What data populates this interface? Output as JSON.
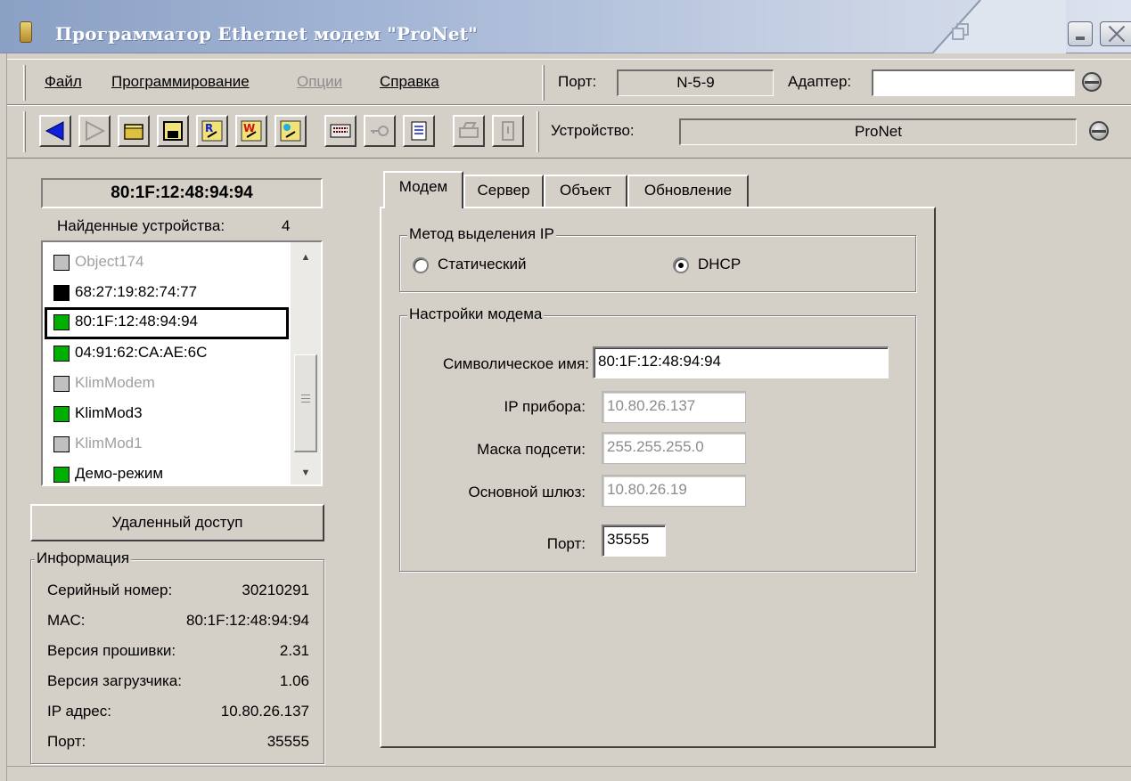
{
  "window": {
    "title": "Программатор Ethernet модем \"ProNet\""
  },
  "menu": {
    "items": [
      {
        "label": "Файл",
        "enabled": true
      },
      {
        "label": "Программирование",
        "enabled": true
      },
      {
        "label": "Опции",
        "enabled": false
      },
      {
        "label": "Справка",
        "enabled": true
      }
    ],
    "port_label": "Порт:",
    "port_value": "N-5-9",
    "adapter_label": "Адаптер:",
    "adapter_value": ""
  },
  "toolbar": {
    "buttons": [
      {
        "icon": "back-arrow-icon",
        "enabled": true
      },
      {
        "icon": "forward-arrow-icon",
        "enabled": false
      },
      {
        "icon": "open-folder-icon",
        "enabled": true
      },
      {
        "icon": "save-disk-icon",
        "enabled": true
      },
      {
        "icon": "read-device-icon",
        "enabled": true
      },
      {
        "icon": "write-device-icon",
        "enabled": true
      },
      {
        "icon": "program-device-icon",
        "enabled": true
      },
      {
        "icon": "keyboard-icon",
        "enabled": true
      },
      {
        "icon": "key-icon",
        "enabled": false
      },
      {
        "icon": "document-icon",
        "enabled": true
      },
      {
        "icon": "printer-icon",
        "enabled": false
      },
      {
        "icon": "help-book-icon",
        "enabled": false
      }
    ],
    "device_label": "Устройство:",
    "device_value": "ProNet"
  },
  "left_panel": {
    "current_mac": "80:1F:12:48:94:94",
    "found_label": "Найденные устройства:",
    "found_count": "4",
    "devices": [
      {
        "name": "Object174",
        "color": "#c0c0c0",
        "active": false,
        "selected": false
      },
      {
        "name": "68:27:19:82:74:77",
        "color": "#000000",
        "active": true,
        "selected": false
      },
      {
        "name": "80:1F:12:48:94:94",
        "color": "#00b000",
        "active": true,
        "selected": true
      },
      {
        "name": "04:91:62:CA:AE:6C",
        "color": "#00b000",
        "active": true,
        "selected": false
      },
      {
        "name": "KlimModem",
        "color": "#c0c0c0",
        "active": false,
        "selected": false
      },
      {
        "name": "KlimMod3",
        "color": "#00b000",
        "active": true,
        "selected": false
      },
      {
        "name": "KlimMod1",
        "color": "#c0c0c0",
        "active": false,
        "selected": false
      },
      {
        "name": "Демо-режим",
        "color": "#00b000",
        "active": true,
        "selected": false
      }
    ],
    "remote_access_label": "Удаленный доступ",
    "info": {
      "title": "Информация",
      "rows": [
        {
          "key": "Серийный номер:",
          "value": "30210291"
        },
        {
          "key": "MAC:",
          "value": "80:1F:12:48:94:94"
        },
        {
          "key": "Версия прошивки:",
          "value": "2.31"
        },
        {
          "key": "Версия загрузчика:",
          "value": "1.06"
        },
        {
          "key": "IP адрес:",
          "value": "10.80.26.137"
        },
        {
          "key": "Порт:",
          "value": "35555"
        }
      ]
    }
  },
  "tabs": [
    {
      "label": "Модем",
      "active": true
    },
    {
      "label": "Сервер",
      "active": false
    },
    {
      "label": "Объект",
      "active": false
    },
    {
      "label": "Обновление",
      "active": false
    }
  ],
  "modem_tab": {
    "ip_method": {
      "title": "Метод выделения IP",
      "options": [
        {
          "label": "Статический",
          "checked": false
        },
        {
          "label": "DHCP",
          "checked": true
        }
      ]
    },
    "settings": {
      "title": "Настройки модема",
      "fields": [
        {
          "label": "Символическое имя:",
          "value": "80:1F:12:48:94:94",
          "enabled": true
        },
        {
          "label": "IP прибора:",
          "value": "10.80.26.137",
          "enabled": false
        },
        {
          "label": "Маска подсети:",
          "value": "255.255.255.0",
          "enabled": false
        },
        {
          "label": "Основной шлюз:",
          "value": "10.80.26.19",
          "enabled": false
        },
        {
          "label": "Порт:",
          "value": "35555",
          "enabled": true
        }
      ]
    }
  }
}
